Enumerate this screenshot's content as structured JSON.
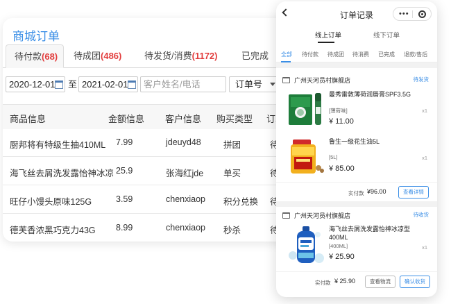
{
  "admin": {
    "title": "商城订单",
    "tabs": [
      {
        "label": "待付款",
        "count": "(68)"
      },
      {
        "label": "待成团",
        "count": "(486)"
      },
      {
        "label": "待发货/消费",
        "count": "(1172)"
      },
      {
        "label": "已完成",
        "count": ""
      }
    ],
    "filters": {
      "start_date": "2020-12-01",
      "to_label": "至",
      "end_date": "2021-02-01",
      "search_placeholder": "客户姓名/电话",
      "select_value": "订单号"
    },
    "columns": [
      "商品信息",
      "金额信息",
      "客户信息",
      "购买类型",
      "订单"
    ],
    "rows": [
      {
        "product": "厨邦将有特级生抽410ML",
        "amount": "7.99",
        "customer": "jdeuyd48",
        "type": "拼团",
        "status": "待"
      },
      {
        "product": "海飞丝去屑洗发露怡神冰凉",
        "amount": "25.9",
        "customer": "张海红jde",
        "type": "单买",
        "status": "待"
      },
      {
        "product": "旺仔小馒头原味125G",
        "amount": "3.59",
        "customer": "chenxiaop",
        "type": "积分兑换",
        "status": "待"
      },
      {
        "product": "德芙香浓黑巧克力43G",
        "amount": "8.99",
        "customer": "chenxiaop",
        "type": "秒杀",
        "status": "待"
      }
    ]
  },
  "phone": {
    "title": "订单记录",
    "capsule_dots": "•••",
    "main_tabs": [
      "线上订单",
      "线下订单"
    ],
    "sub_tabs": [
      "全部",
      "待付款",
      "待成团",
      "待消费",
      "已完成",
      "退款/售后"
    ],
    "orders": [
      {
        "shop": "广州天河员村旗舰店",
        "status": "待发货",
        "items": [
          {
            "name": "曼秀雷敦薄荷润唇膏SPF3.5G",
            "spec": "[薄荷味]",
            "price": "¥ 11.00",
            "qty": "x1"
          },
          {
            "name": "鲁生一级花生油5L",
            "spec": "[5L]",
            "price": "¥ 85.00",
            "qty": "x1"
          }
        ],
        "paid_label": "实付款",
        "paid_value": "¥96.00",
        "buttons": [
          "查看详情"
        ]
      },
      {
        "shop": "广州天河员村旗舰店",
        "status": "待收货",
        "items": [
          {
            "name": "海飞丝去屑洗发露怡神冰凉型400ML",
            "spec": "[400ML]",
            "price": "¥ 25.90",
            "qty": "x1"
          }
        ],
        "paid_label": "实付款",
        "paid_value": "¥ 25.90",
        "buttons": [
          "查看物流",
          "确认收货"
        ]
      }
    ]
  },
  "colors": {
    "accent": "#3a8ee6",
    "count_red": "#e23d3d"
  }
}
